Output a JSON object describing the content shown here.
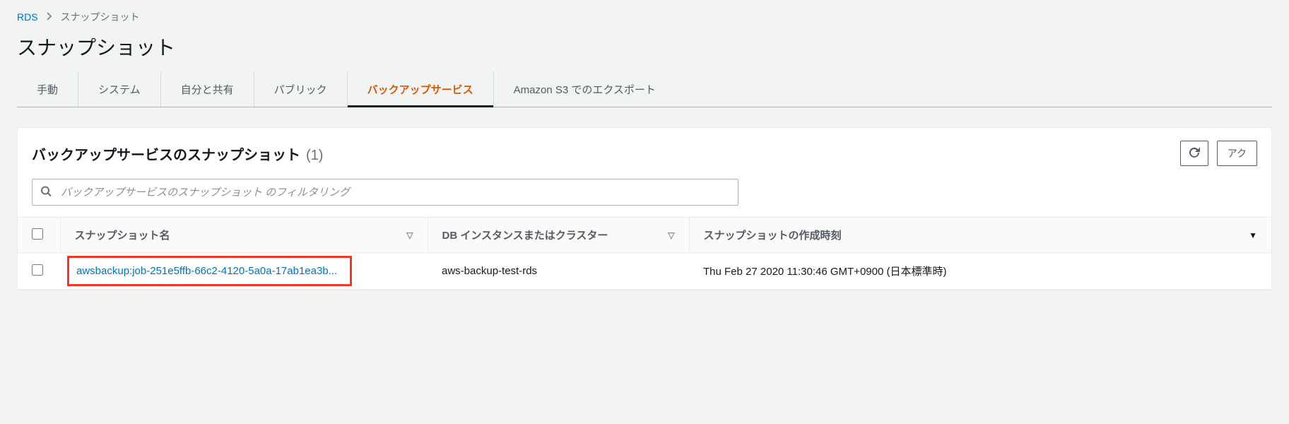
{
  "breadcrumb": {
    "root": "RDS",
    "current": "スナップショット"
  },
  "pageTitle": "スナップショット",
  "tabs": [
    {
      "label": "手動",
      "active": false
    },
    {
      "label": "システム",
      "active": false
    },
    {
      "label": "自分と共有",
      "active": false
    },
    {
      "label": "パブリック",
      "active": false
    },
    {
      "label": "バックアップサービス",
      "active": true
    },
    {
      "label": "Amazon S3 でのエクスポート",
      "active": false
    }
  ],
  "panel": {
    "title": "バックアップサービスのスナップショット",
    "count": "(1)",
    "actionsLabel": "アク",
    "filterPlaceholder": "バックアップサービスのスナップショット のフィルタリング"
  },
  "columns": {
    "name": "スナップショット名",
    "db": "DB インスタンスまたはクラスター",
    "time": "スナップショットの作成時刻"
  },
  "rows": [
    {
      "name": "awsbackup:job-251e5ffb-66c2-4120-5a0a-17ab1ea3b...",
      "db": "aws-backup-test-rds",
      "time": "Thu Feb 27 2020 11:30:46 GMT+0900 (日本標準時)"
    }
  ]
}
